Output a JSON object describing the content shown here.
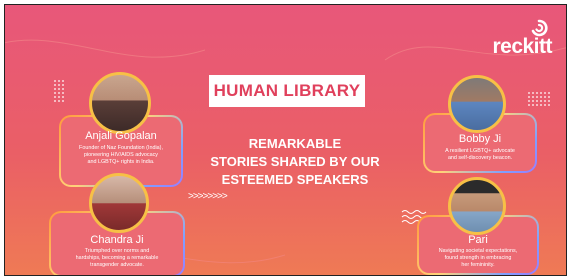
{
  "brand": {
    "logo_text": "reckitt",
    "colors": {
      "background_top": "#e8577a",
      "background_bottom": "#ef7a55",
      "accent_title": "#e0405c",
      "avatar_ring": "#f7c046"
    }
  },
  "title": "HUMAN LIBRARY",
  "headline": [
    "REMARKABLE",
    "STORIES SHARED BY OUR",
    "ESTEEMED SPEAKERS"
  ],
  "arrows": ">>>>>>>>",
  "speakers": [
    {
      "name": "Anjali Gopalan",
      "description": [
        "Founder of Naz Foundation (India),",
        "pioneering HIV/AIDS advocacy",
        "and LGBTQ+ rights in India."
      ]
    },
    {
      "name": "Chandra Ji",
      "description": [
        "Triumphed over norms and",
        "hardships, becoming a remarkable",
        "transgender advocate."
      ]
    },
    {
      "name": "Bobby Ji",
      "description": [
        "A resilient LGBTQ+ advocate",
        "and self-discovery beacon."
      ]
    },
    {
      "name": "Pari",
      "description": [
        "Navigating societal expectations,",
        "found strength in embracing",
        "her femininity."
      ]
    }
  ]
}
